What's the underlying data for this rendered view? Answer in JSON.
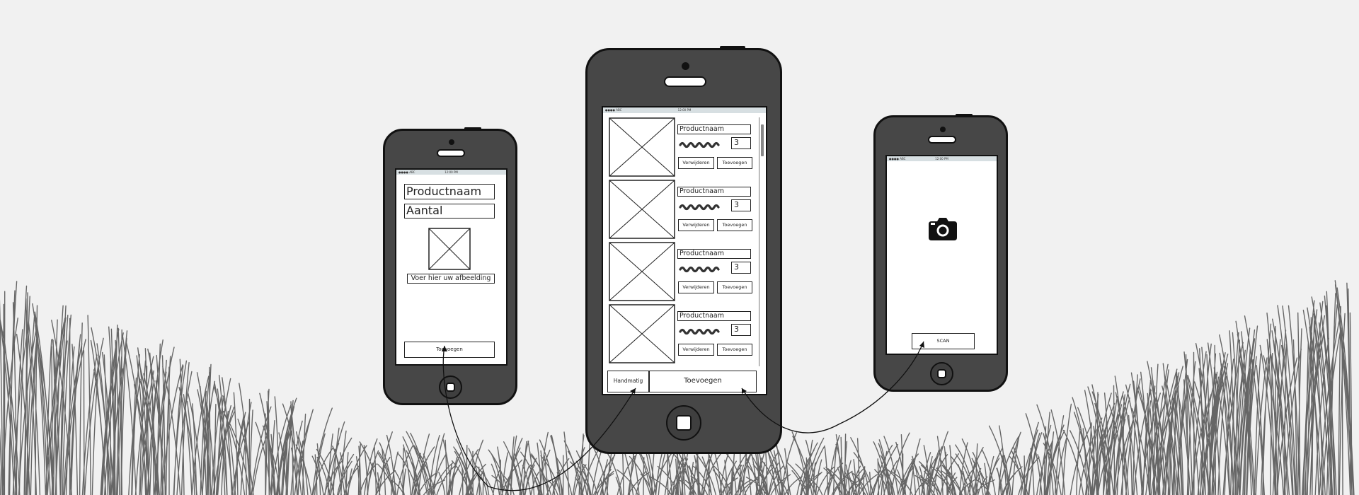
{
  "colors": {
    "paper": "#f1f1f1",
    "phone_body": "#474747",
    "outline": "#111111",
    "screen": "#ffffff",
    "status_bar": "#d7dfe2",
    "grass": "#4e4e4e"
  },
  "phone_left": {
    "statusbar": {
      "carrier": "●●●● ABC",
      "time": "12:00 PM"
    },
    "product_name_field": "Productnaam",
    "quantity_field": "Aantal",
    "image_placeholder_icon": "image-placeholder-icon",
    "image_caption": "Voer hier uw afbeelding",
    "add_button": "Toevoegen"
  },
  "phone_center": {
    "statusbar": {
      "carrier": "●●●● ABC",
      "time": "12:00 PM"
    },
    "items": [
      {
        "name": "Productnaam",
        "quantity": "3",
        "remove_label": "Verwijderen",
        "add_label": "Toevoegen"
      },
      {
        "name": "Productnaam",
        "quantity": "3",
        "remove_label": "Verwijderen",
        "add_label": "Toevoegen"
      },
      {
        "name": "Productnaam",
        "quantity": "3",
        "remove_label": "Verwijderen",
        "add_label": "Toevoegen"
      },
      {
        "name": "Productnaam",
        "quantity": "3",
        "remove_label": "Verwijderen",
        "add_label": "Toevoegen"
      }
    ],
    "manual_button": "Handmatig",
    "add_button": "Toevoegen"
  },
  "phone_right": {
    "statusbar": {
      "carrier": "●●●● ABC",
      "time": "12:00 PM"
    },
    "camera_icon": "camera-icon",
    "scan_button": "SCAN"
  }
}
